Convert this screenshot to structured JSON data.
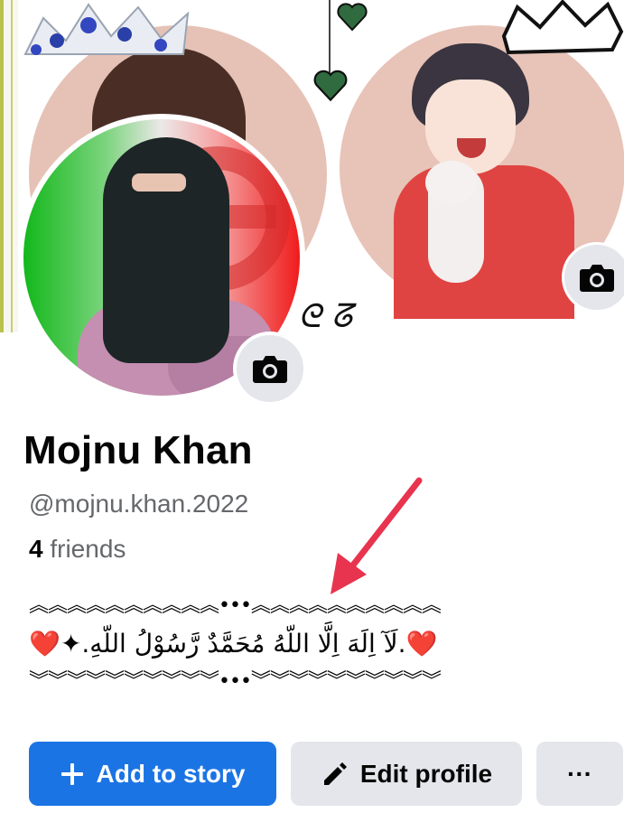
{
  "profile": {
    "name": "Mojnu Khan",
    "username": "@mojnu.khan.2022",
    "friends_count": "4",
    "friends_label": "friends"
  },
  "bio": {
    "line1": "︽︽︽︽︽︽︽︽︽︽•••︽︽︽︽︽︽︽︽︽︽",
    "line2": "❤️.لَآ اِلَهَ اِلَّا اللّهُ مُحَمَّدٌ رَّسُوْلُ اللّهِ.✦❤️",
    "line3": "︾︾︾︾︾︾︾︾︾︾•••︾︾︾︾︾︾︾︾︾︾"
  },
  "actions": {
    "add_story_label": "Add to story",
    "edit_profile_label": "Edit profile",
    "more_label": "···"
  },
  "icons": {
    "cover_camera": "camera-icon",
    "avatar_camera": "camera-icon",
    "add": "plus-icon",
    "edit": "pencil-icon",
    "more": "more-icon"
  },
  "colors": {
    "primary": "#1b74e4",
    "secondary_button": "#e4e6eb",
    "arrow": "#e8344e",
    "muted_text": "#65676b"
  }
}
